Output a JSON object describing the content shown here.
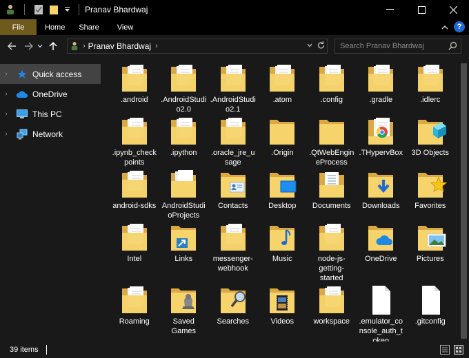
{
  "window": {
    "title": "Pranav Bhardwaj",
    "minimize": "—",
    "maximize": "☐",
    "close": "✕"
  },
  "ribbon": {
    "tabs": [
      "File",
      "Home",
      "Share",
      "View"
    ],
    "help": "?"
  },
  "address": {
    "crumb": "Pranav Bhardwaj",
    "search_placeholder": "Search Pranav Bhardwaj"
  },
  "nav": {
    "items": [
      {
        "label": "Quick access",
        "icon": "star-icon",
        "selected": true
      },
      {
        "label": "OneDrive",
        "icon": "cloud-icon",
        "selected": false
      },
      {
        "label": "This PC",
        "icon": "monitor-icon",
        "selected": false
      },
      {
        "label": "Network",
        "icon": "network-icon",
        "selected": false
      }
    ]
  },
  "items": [
    {
      "label": ".android",
      "icon": "folder-docs"
    },
    {
      "label": ".AndroidStudio2.0",
      "icon": "folder-docs"
    },
    {
      "label": ".AndroidStudio2.1",
      "icon": "folder-docs"
    },
    {
      "label": ".atom",
      "icon": "folder-docs"
    },
    {
      "label": ".config",
      "icon": "folder-docs"
    },
    {
      "label": ".gradle",
      "icon": "folder-docs"
    },
    {
      "label": ".idlerc",
      "icon": "folder-docs"
    },
    {
      "label": ".ipynb_checkpoints",
      "icon": "folder-docs"
    },
    {
      "label": ".ipython",
      "icon": "folder-docs"
    },
    {
      "label": ".oracle_jre_usage",
      "icon": "folder-docs"
    },
    {
      "label": ".Origin",
      "icon": "folder"
    },
    {
      "label": ".QtWebEngineProcess",
      "icon": "folder"
    },
    {
      "label": ".THypervBox",
      "icon": "folder-chrome"
    },
    {
      "label": "3D Objects",
      "icon": "folder-3d"
    },
    {
      "label": "android-sdks",
      "icon": "folder-docs"
    },
    {
      "label": "AndroidStudioProjects",
      "icon": "folder-white"
    },
    {
      "label": "Contacts",
      "icon": "folder-contacts"
    },
    {
      "label": "Desktop",
      "icon": "folder-desktop"
    },
    {
      "label": "Documents",
      "icon": "folder-documents"
    },
    {
      "label": "Downloads",
      "icon": "folder-downloads"
    },
    {
      "label": "Favorites",
      "icon": "folder-favorites"
    },
    {
      "label": "Intel",
      "icon": "folder-docs"
    },
    {
      "label": "Links",
      "icon": "folder-links"
    },
    {
      "label": "messenger-webhook",
      "icon": "folder-docs"
    },
    {
      "label": "Music",
      "icon": "folder-music"
    },
    {
      "label": "node-js-getting-started",
      "icon": "folder-docs"
    },
    {
      "label": "OneDrive",
      "icon": "folder-onedrive"
    },
    {
      "label": "Pictures",
      "icon": "folder-pictures"
    },
    {
      "label": "Roaming",
      "icon": "folder-docs"
    },
    {
      "label": "Saved Games",
      "icon": "folder-games"
    },
    {
      "label": "Searches",
      "icon": "folder-searches"
    },
    {
      "label": "Videos",
      "icon": "folder-videos"
    },
    {
      "label": "workspace",
      "icon": "folder-docs"
    },
    {
      "label": ".emulator_console_auth_token",
      "icon": "file-blank"
    },
    {
      "label": ".gitconfig",
      "icon": "file-blank"
    }
  ],
  "status": {
    "count": "39 items"
  },
  "colors": {
    "folder_back": "#dba943",
    "folder_front": "#f6d36b",
    "selection": "#434343",
    "accent": "#1e6ad6"
  }
}
